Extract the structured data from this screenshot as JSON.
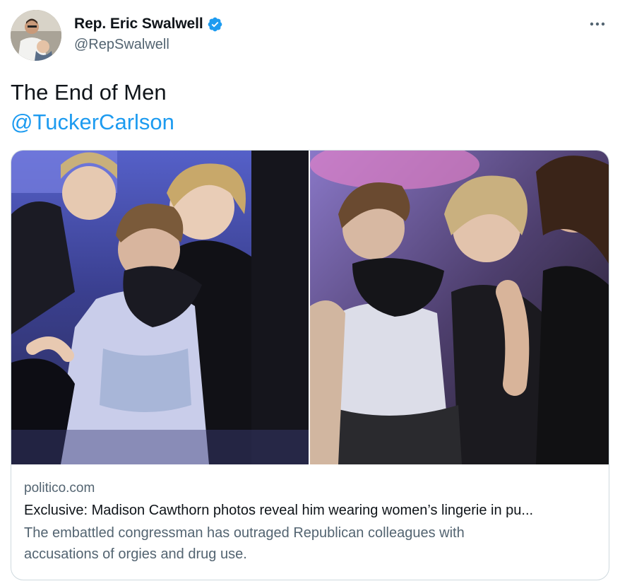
{
  "author": {
    "display_name": "Rep. Eric Swalwell",
    "handle": "@RepSwalwell",
    "verified_icon": "verified-badge-icon",
    "avatar_icon": "profile-photo"
  },
  "menu": {
    "icon": "more-options-icon"
  },
  "tweet": {
    "line1": "The End of Men",
    "mention": "@TuckerCarlson"
  },
  "card": {
    "domain": "politico.com",
    "title": "Exclusive: Madison Cawthorn photos reveal him wearing women’s lingerie in pu...",
    "description_line1": "The embattled congressman has outraged Republican colleagues with",
    "description_line2": "accusations of orgies and drug use."
  },
  "colors": {
    "link": "#1d9bf0",
    "text": "#0f1419",
    "secondary": "#536471",
    "border": "#cfd9de"
  }
}
